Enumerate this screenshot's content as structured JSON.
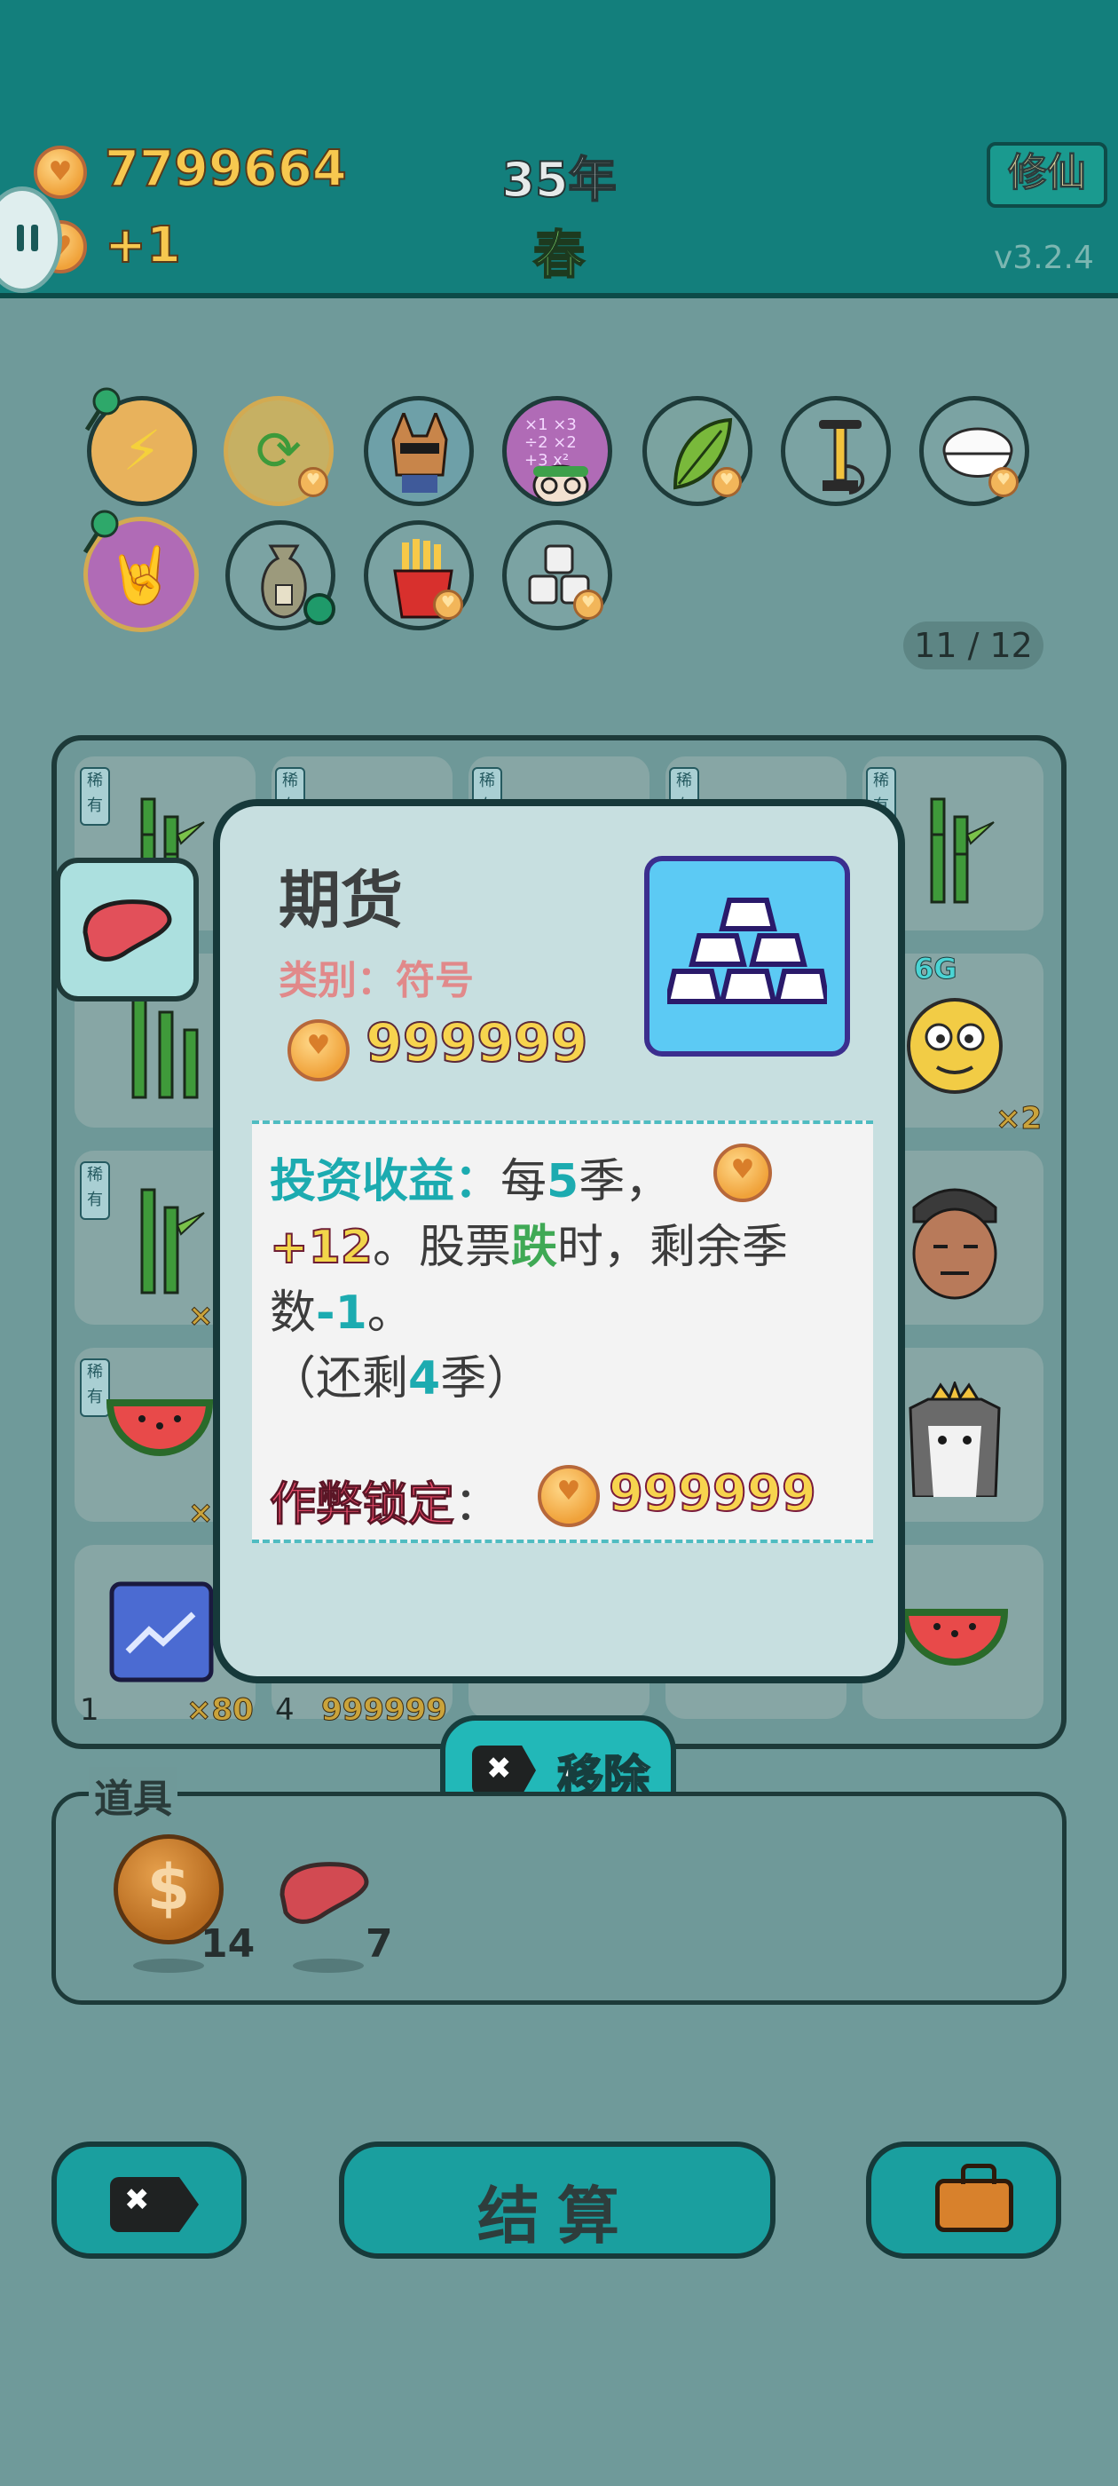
{
  "header": {
    "coins": "7799664",
    "income": "+1",
    "year": "35年",
    "season": "春",
    "mode_button": "修仙",
    "version": "v3.2.4"
  },
  "skills": {
    "row1": [
      "lightning-icon",
      "refresh-icon",
      "cool-dog-icon",
      "math-brain-icon",
      "leaf-icon",
      "pump-icon",
      "rice-bowl-icon"
    ],
    "row2": [
      "rock-hand-icon",
      "sack-icon",
      "fries-icon",
      "sugar-cubes-icon"
    ],
    "counter": "11 / 12"
  },
  "board": {
    "rare_tag": "稀有",
    "tag_6g": "6G",
    "mult_x2": "×2",
    "mult_x_partial": "×",
    "row5_left_count": "1",
    "row5_left_mult": "×80",
    "row5_mid_count": "4",
    "row5_mid_value": "999999"
  },
  "modal": {
    "title": "期货",
    "category": "类别：符号",
    "price": "999999",
    "line1_prefix": "投资收益：",
    "line1_mid": "每",
    "line1_num": "5",
    "line1_suffix": "季，",
    "line2_plus": "+12",
    "line2_text": "。股票",
    "line2_fall": "跌",
    "line2_rest": "时，剩余季",
    "line3_text": "数",
    "line3_num": "-1",
    "line3_end": "。",
    "line4_open": "（还剩",
    "line4_num": "4",
    "line4_close": "季）",
    "cheat_label": "作弊锁定",
    "cheat_colon": "：",
    "cheat_value": "999999"
  },
  "remove_button": "移除",
  "props": {
    "title": "道具",
    "items": [
      {
        "icon": "dollar-coin-icon",
        "count": "14"
      },
      {
        "icon": "liver-icon",
        "count": "7"
      }
    ]
  },
  "bottom": {
    "settle": "结算"
  },
  "colors": {
    "topbar": "#137f7c",
    "accent_teal": "#1cabb0",
    "gold": "#f7c84f",
    "cheat_pink": "#ee4e6d"
  }
}
